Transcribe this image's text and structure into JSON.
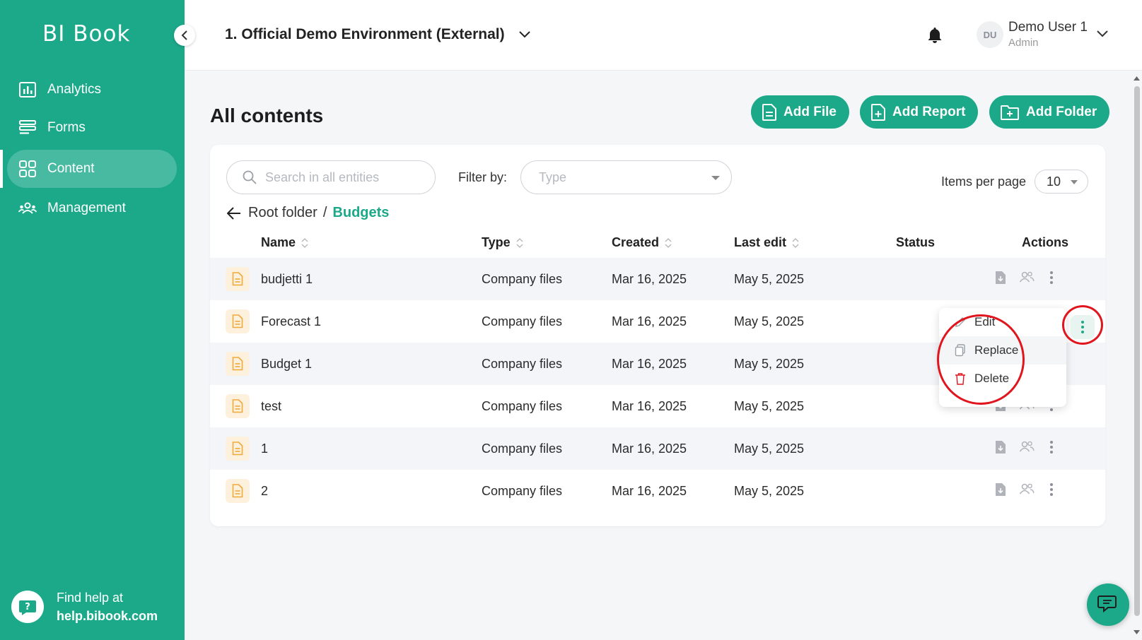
{
  "app": {
    "logo": "BI Book"
  },
  "sidebar": {
    "items": [
      {
        "label": "Analytics",
        "icon": "bar-chart-icon"
      },
      {
        "label": "Forms",
        "icon": "forms-icon"
      },
      {
        "label": "Content",
        "icon": "grid-icon",
        "active": true
      },
      {
        "label": "Management",
        "icon": "users-icon"
      }
    ],
    "help_line1": "Find help at",
    "help_line2": "help.bibook.com"
  },
  "header": {
    "environment": "1. Official Demo Environment (External)",
    "user_initials": "DU",
    "user_name": "Demo User 1",
    "user_role": "Admin"
  },
  "main": {
    "title": "All contents",
    "buttons": {
      "add_file": "Add File",
      "add_report": "Add Report",
      "add_folder": "Add Folder"
    },
    "search_placeholder": "Search in all entities",
    "filter_label": "Filter by:",
    "type_placeholder": "Type",
    "items_per_page_label": "Items per page",
    "items_per_page_value": "10",
    "breadcrumb": {
      "root": "Root folder",
      "separator": "/",
      "current": "Budgets"
    },
    "columns": {
      "name": "Name",
      "type": "Type",
      "created": "Created",
      "last_edit": "Last edit",
      "status": "Status",
      "actions": "Actions"
    },
    "rows": [
      {
        "name": "budjetti 1",
        "type": "Company files",
        "created": "Mar 16, 2025",
        "last_edit": "May 5, 2025"
      },
      {
        "name": "Forecast 1",
        "type": "Company files",
        "created": "Mar 16, 2025",
        "last_edit": "May 5, 2025"
      },
      {
        "name": "Budget 1",
        "type": "Company files",
        "created": "Mar 16, 2025",
        "last_edit": "May 5, 2025"
      },
      {
        "name": "test",
        "type": "Company files",
        "created": "Mar 16, 2025",
        "last_edit": "May 5, 2025"
      },
      {
        "name": "1",
        "type": "Company files",
        "created": "Mar 16, 2025",
        "last_edit": "May 5, 2025"
      },
      {
        "name": "2",
        "type": "Company files",
        "created": "Mar 16, 2025",
        "last_edit": "May 5, 2025"
      }
    ],
    "context_menu": {
      "edit": "Edit",
      "replace": "Replace",
      "delete": "Delete"
    }
  },
  "colors": {
    "brand": "#1ba98a",
    "file_icon": "#f0a93b",
    "delete": "#e0151e",
    "annotation": "#e0151e"
  }
}
